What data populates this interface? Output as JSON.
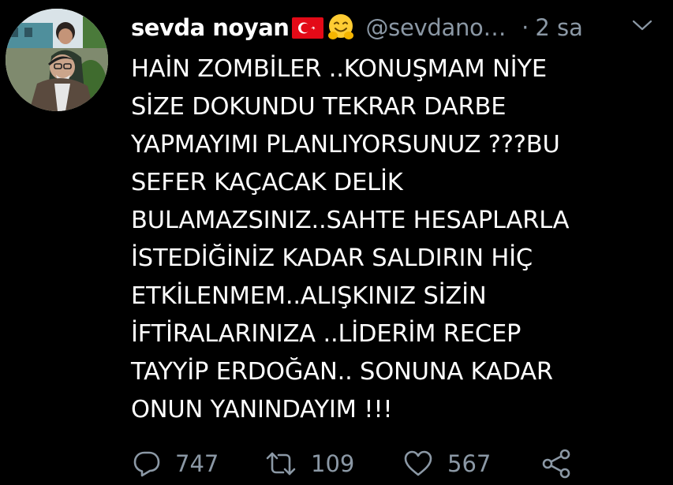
{
  "tweet": {
    "display_name": "sevda noyan",
    "handle": "@sevdano…",
    "separator": "·",
    "time": "2 sa",
    "flag_icon": "turkey-flag-icon",
    "emoji_icon": "hugging-face-icon",
    "text_lines": [
      "HAİN ZOMBİLER ..KONUŞMAM NİYE",
      "SİZE DOKUNDU TEKRAR DARBE",
      "YAPMAYIMI PLANLIYORSUNUZ ???BU",
      "SEFER KAÇACAK DELİK",
      "BULAMAZSINIZ..SAHTE HESAPLARLA",
      "İSTEDİĞİNİZ KADAR SALDIRIN HİÇ",
      "ETKİLENMEM..ALIŞKINIZ SİZİN",
      "İFTİRALARINIZA ..LİDERİM RECEP",
      "TAYYİP ERDOĞAN.. SONUNA KADAR",
      "ONUN YANINDAYIM !!!"
    ]
  },
  "actions": {
    "replies": "747",
    "retweets": "109",
    "likes": "567"
  },
  "colors": {
    "background": "#000000",
    "text": "#ffffff",
    "secondary": "#8b98a5",
    "flag_red": "#e30a17"
  }
}
